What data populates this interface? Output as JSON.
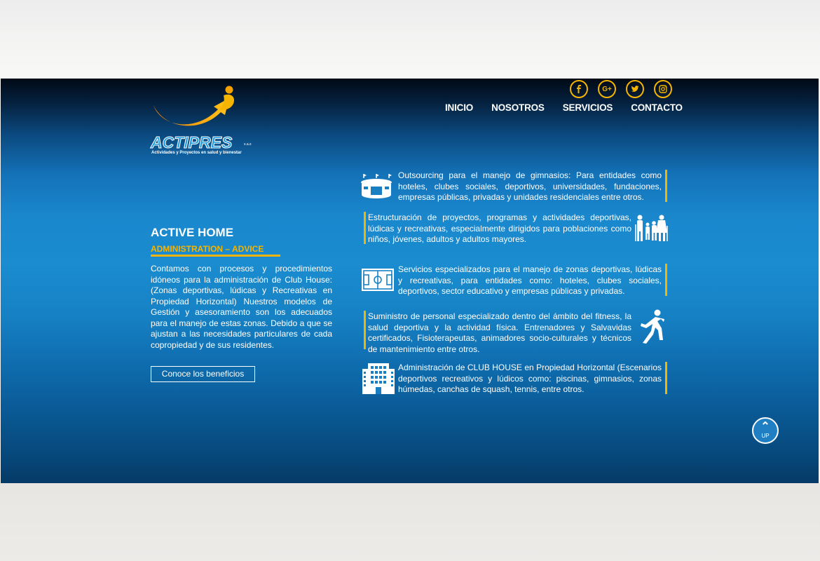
{
  "social": {
    "icons": [
      "facebook-icon",
      "google-plus-icon",
      "twitter-icon",
      "instagram-icon"
    ],
    "gplus_glyph": "G+"
  },
  "nav": {
    "items": [
      "INICIO",
      "NOSOTROS",
      "SERVICIOS",
      "CONTACTO"
    ]
  },
  "logo": {
    "brand": "ACTIPRES",
    "suffix": "s.a.s",
    "tagline": "Actividades y Proyectos en salud y bienestar"
  },
  "left": {
    "title": "ACTIVE HOME",
    "subtitle": "ADMINISTRATION – ADVICE",
    "body": "Contamos con procesos y procedimientos idóneos para la administración de Club House: (Zonas deportivas, lúdicas y Recreativas en Propiedad Horizontal) Nuestros modelos de Gestión y asesoramiento son los adecuados para el manejo de estas zonas. Debido a que se ajustan a las necesidades particulares de cada copropiedad y de sus residentes.",
    "button": "Conoce los beneficios"
  },
  "services": [
    "Outsourcing para el manejo de gimnasios: Para entidades como hoteles, clubes sociales, deportivos, universidades, fundaciones, empresas públicas, privadas y unidades residenciales entre otros.",
    "Estructuración de proyectos, programas y actividades deportivas, lúdicas y recreativas, especialmente dirigidos para poblaciones como niños, jóvenes, adultos y adultos mayores.",
    "Servicios especializados para el manejo de zonas deportivas, lúdicas y recreativas, para entidades como: hoteles, clubes sociales, deportivos, sector educativo y empresas públicas y privadas.",
    "Suministro de personal especializado dentro del ámbito del fitness, la salud deportiva y la actividad física. Entrenadores y Salvavidas certificados, Fisioterapeutas, animadores socio-culturales y técnicos de mantenimiento entre otros.",
    "Administración de CLUB HOUSE en Propiedad Horizontal (Escenarios deportivos recreativos y lúdicos como: piscinas, gimnasios, zonas húmedas, canchas de squash, tennis, entre otros."
  ],
  "up_button": {
    "label": "UP"
  },
  "colors": {
    "accent": "#f5b400",
    "primary": "#1a87cd",
    "dark": "#010a16"
  }
}
